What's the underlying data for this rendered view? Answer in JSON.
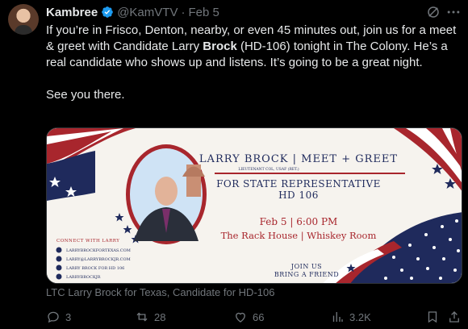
{
  "tweet": {
    "display_name": "Kambree",
    "handle": "@KamVTV",
    "date": "Feb 5",
    "body": {
      "p1_before": "If you’re in Frisco, Denton, nearby, or even 45 minutes out, join us for a meet & greet with Candidate Larry ",
      "p1_bold": "Brock",
      "p1_after": " (HD-106) tonight in The Colony. He’s a real candidate who shows up and listens. It’s going to be a great night.",
      "p2": "See you there."
    },
    "link_caption": "LTC Larry Brock for Texas, Candidate for HD-106"
  },
  "flyer": {
    "headline": "LARRY BROCK | MEET + GREET",
    "subline": "LIEUTENANT COL, USAF (RET.)",
    "office_line1": "FOR STATE REPRESENTATIVE",
    "office_line2": "HD 106",
    "event_line1": "Feb 5 | 6:00 PM",
    "event_line2": "The Rack House | Whiskey Room",
    "connect_title": "CONNECT WITH LARRY",
    "connect_items": [
      "LARRYBROCKFORTEXAS.COM",
      "LARRY@LARRYBROCKJR.COM",
      "LARRY BROCK FOR HD 106",
      "LARRYBROCKJR"
    ],
    "cta_line1": "JOIN US",
    "cta_line2": "BRING A FRIEND"
  },
  "actions": {
    "replies": "3",
    "reposts": "28",
    "likes": "66",
    "views": "3.2K"
  },
  "colors": {
    "verified": "#1d9bf0",
    "flyer_red": "#a8262d",
    "flyer_navy": "#1f2a5c",
    "muted": "#71767b"
  }
}
